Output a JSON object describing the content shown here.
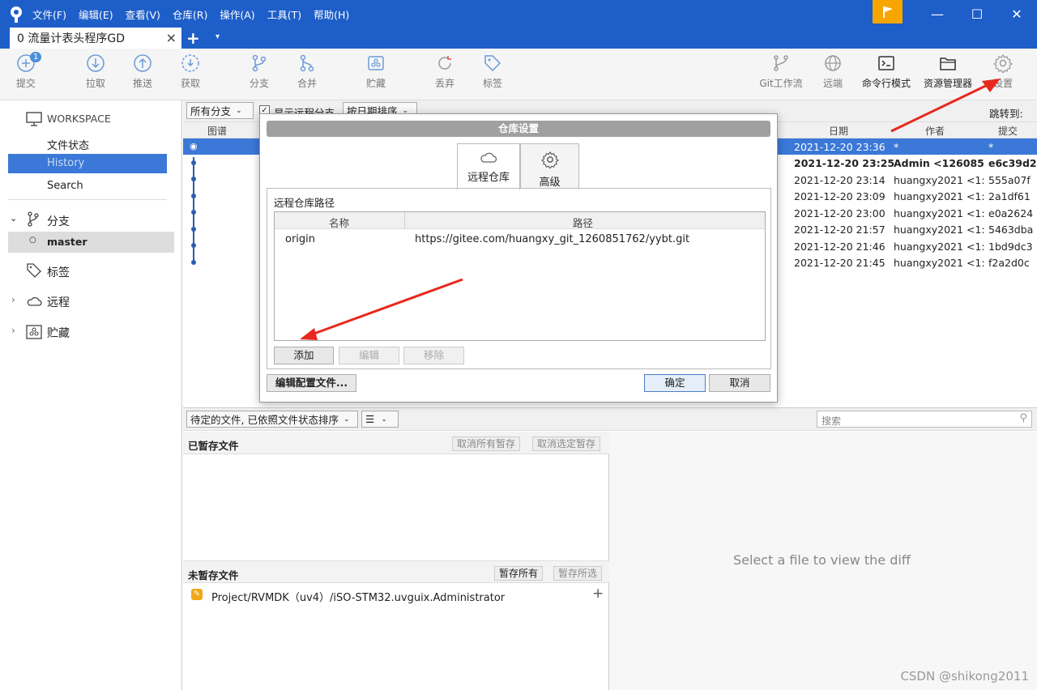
{
  "menu": [
    "文件(F)",
    "编辑(E)",
    "查看(V)",
    "仓库(R)",
    "操作(A)",
    "工具(T)",
    "帮助(H)"
  ],
  "tab": {
    "title": "0 流量计表头程序GD",
    "close": "×",
    "add": "+",
    "dropdown": "▾"
  },
  "toolbar": {
    "commit": "提交",
    "commit_badge": "1",
    "pull": "拉取",
    "push": "推送",
    "fetch": "获取",
    "branch": "分支",
    "merge": "合并",
    "stash": "贮藏",
    "discard": "丢弃",
    "tag": "标签",
    "gitflow": "Git工作流",
    "remote": "远端",
    "terminal": "命令行模式",
    "explorer": "资源管理器",
    "settings": "设置"
  },
  "sidebar": {
    "workspace": "WORKSPACE",
    "file_status": "文件状态",
    "history": "History",
    "search": "Search",
    "branches": "分支",
    "master": "master",
    "tags": "标签",
    "remotes": "远程",
    "stashes": "贮藏"
  },
  "history": {
    "branch_filter": "所有分支",
    "show_remote": "显示远程分支",
    "sort": "按日期排序",
    "jump": "跳转到:",
    "col_graph": "图谱",
    "col_date": "日期",
    "col_author": "作者",
    "col_commit": "提交",
    "rows": [
      {
        "date": "2021-12-20 23:36",
        "author": "*",
        "commit": "*"
      },
      {
        "date": "2021-12-20 23:25",
        "author": "Admin <126085",
        "commit": "e6c39d2"
      },
      {
        "date": "2021-12-20 23:14",
        "author": "huangxy2021 <1:",
        "commit": "555a07f"
      },
      {
        "date": "2021-12-20 23:09",
        "author": "huangxy2021 <1:",
        "commit": "2a1df61"
      },
      {
        "date": "2021-12-20 23:00",
        "author": "huangxy2021 <1:",
        "commit": "e0a2624"
      },
      {
        "date": "2021-12-20 21:57",
        "author": "huangxy2021 <1:",
        "commit": "5463dba"
      },
      {
        "date": "2021-12-20 21:46",
        "author": "huangxy2021 <1:",
        "commit": "1bd9dc3"
      },
      {
        "date": "2021-12-20 21:45",
        "author": "huangxy2021 <1:",
        "commit": "f2a2d0c"
      }
    ]
  },
  "lower": {
    "pending_sort": "待定的文件, 已依照文件状态排序",
    "search_placeholder": "搜索",
    "staged_title": "已暂存文件",
    "unstage_all": "取消所有暂存",
    "unstage_selected": "取消选定暂存",
    "unstaged_title": "未暂存文件",
    "stage_all": "暂存所有",
    "stage_selected": "暂存所选",
    "file": "Project/RVMDK（uv4）/iSO-STM32.uvguix.Administrator",
    "diff_hint": "Select a file to view the diff"
  },
  "dialog": {
    "title": "仓库设置",
    "tab_remote": "远程仓库",
    "tab_advanced": "高级",
    "section": "远程仓库路径",
    "col_name": "名称",
    "col_path": "路径",
    "remotes": [
      {
        "name": "origin",
        "url": "https://gitee.com/huangxy_git_1260851762/yybt.git"
      }
    ],
    "add": "添加",
    "edit": "编辑",
    "remove": "移除",
    "edit_config": "编辑配置文件...",
    "ok": "确定",
    "cancel": "取消"
  },
  "watermark": "CSDN @shikong2011",
  "colors": {
    "titlebar": "#1e5ec8",
    "selection": "#3b78d8",
    "flag": "#f7a600",
    "arrow": "#e8281e"
  }
}
